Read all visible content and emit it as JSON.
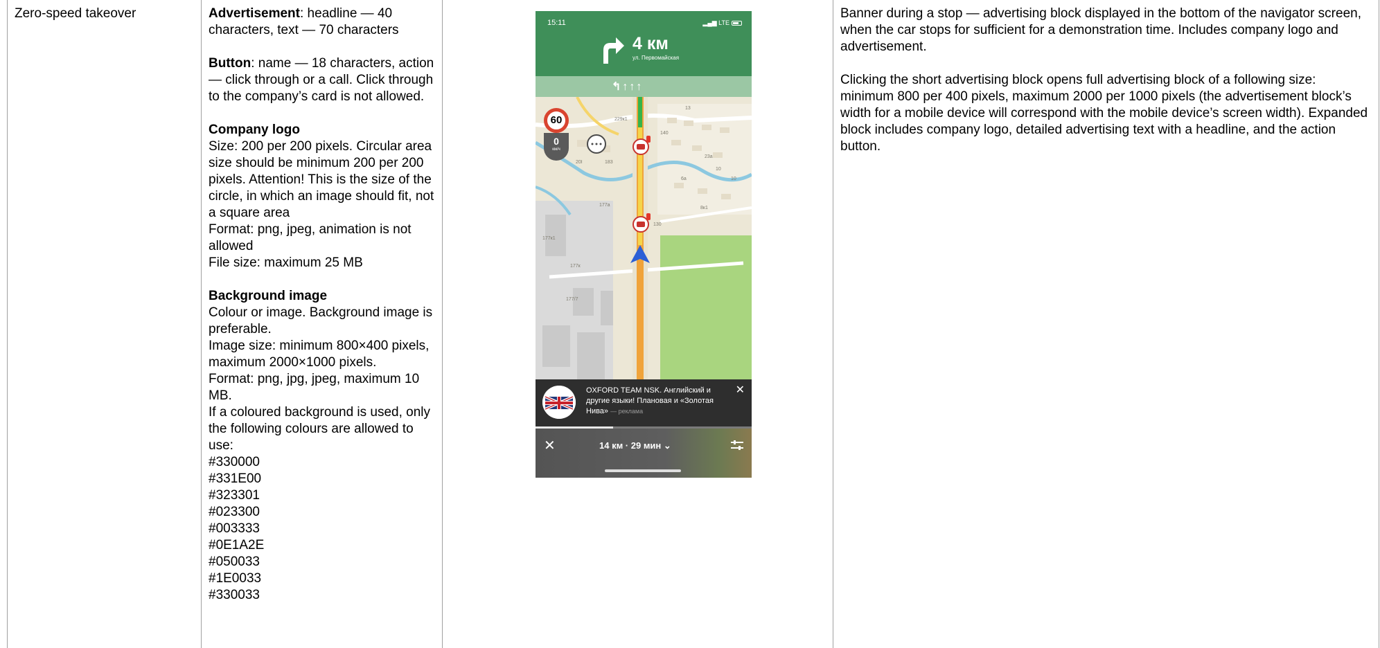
{
  "row": {
    "label": "Zero-speed takeover",
    "requirements": {
      "advertisement": {
        "title": "Advertisement",
        "text": ": headline — 40 characters, text — 70 characters"
      },
      "button": {
        "title": "Button",
        "text": ": name — 18 characters, action — click through or a call. Click through to the company’s card is not allowed."
      },
      "company_logo": {
        "title": "Company logo",
        "lines": [
          "Size: 200 per 200 pixels. Circular area size should be minimum 200 per 200 pixels. Attention! This is the size of the circle, in which an image should fit, not a square area",
          "Format: png, jpeg, animation is not allowed",
          "File size: maximum 25 MB"
        ]
      },
      "background_image": {
        "title": "Background image",
        "lines": [
          "Colour or image. Background image is preferable.",
          "Image size: minimum 800×400 pixels, maximum 2000×1000 pixels.",
          "Format: png, jpg, jpeg, maximum 10 MB.",
          "If a coloured background is used, only the following colours are allowed to use:"
        ],
        "colors": [
          "#330000",
          "#331E00",
          "#323301",
          "#023300",
          "#003333",
          "#0E1A2E",
          "#050033",
          "#1E0033",
          "#330033"
        ]
      }
    },
    "description": {
      "p1": "Banner during a stop — advertising block displayed in the bottom of the navigator screen, when the car stops for sufficient for a demonstration time. Includes company logo and advertisement.",
      "p2": "Clicking the short advertising block opens full advertising block of a following size: minimum 800 per 400 pixels, maximum 2000 per 1000 pixels (the advertisement block’s width for a mobile device will correspond with the mobile device’s screen width). Expanded block includes company logo, detailed advertising text with a headline, and the action button."
    }
  },
  "phone": {
    "status_time": "15:11",
    "status_network": "LTE",
    "distance": "4 км",
    "street": "ул. Первомайская",
    "speed_limit": "60",
    "current_speed": "0",
    "speed_unit": "км/ч",
    "map_labels": [
      "229к1",
      "140",
      "20I",
      "183",
      "23а",
      "177а",
      "177к1",
      "177к",
      "177/7",
      "130",
      "8к1",
      "13",
      "6а",
      "10",
      "10"
    ],
    "ad": {
      "text": "OXFORD TEAM NSK. Английский и другие языки! Плановая и «Золотая Нива»",
      "tag": "— реклама"
    },
    "route": "14 км · 29 мин",
    "progress": 0.36
  }
}
